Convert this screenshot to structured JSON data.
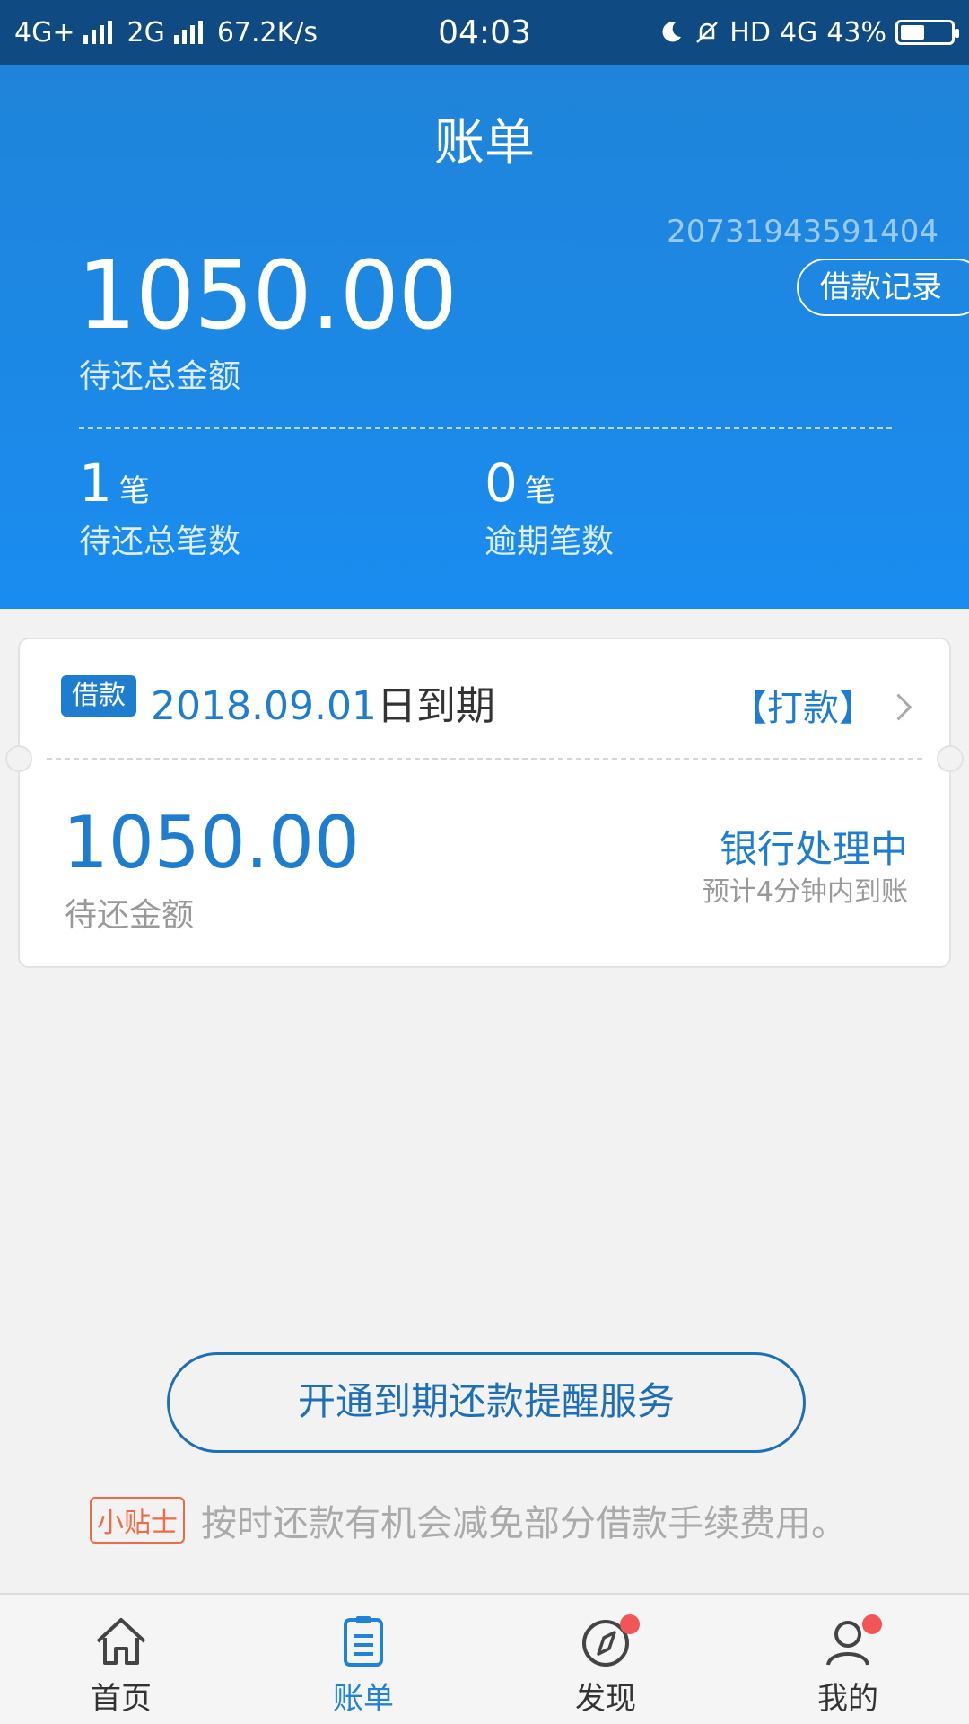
{
  "status_bar": {
    "network1": "4G+",
    "network2": "2G",
    "speed": "67.2K/s",
    "time": "04:03",
    "hd": "HD",
    "network3": "4G",
    "battery": "43%"
  },
  "header": {
    "title": "账单",
    "account_number": "20731943591404",
    "loan_record_label": "借款记录",
    "total_amount": "1050.00",
    "total_amount_label": "待还总金额",
    "pending_count": "1",
    "pending_unit": "笔",
    "pending_label": "待还总笔数",
    "overdue_count": "0",
    "overdue_unit": "笔",
    "overdue_label": "逾期笔数"
  },
  "card": {
    "badge": "借款",
    "due_date": "2018.09.01",
    "due_suffix": "日到期",
    "action_label": "【打款】",
    "amount": "1050.00",
    "amount_label": "待还金额",
    "status": "银行处理中",
    "status_sub": "预计4分钟内到账"
  },
  "reminder": {
    "button_label": "开通到期还款提醒服务",
    "tip_badge": "小贴士",
    "tip_text": "按时还款有机会减免部分借款手续费用。"
  },
  "tabbar": {
    "items": [
      {
        "label": "首页",
        "icon": "home-icon"
      },
      {
        "label": "账单",
        "icon": "bill-icon",
        "active": true
      },
      {
        "label": "发现",
        "icon": "compass-icon",
        "badge": true
      },
      {
        "label": "我的",
        "icon": "user-icon",
        "badge": true
      }
    ]
  },
  "colors": {
    "primary": "#1f84d9",
    "status_bar": "#104a82",
    "tip_accent": "#f06a45",
    "badge_dot": "#f25555"
  }
}
